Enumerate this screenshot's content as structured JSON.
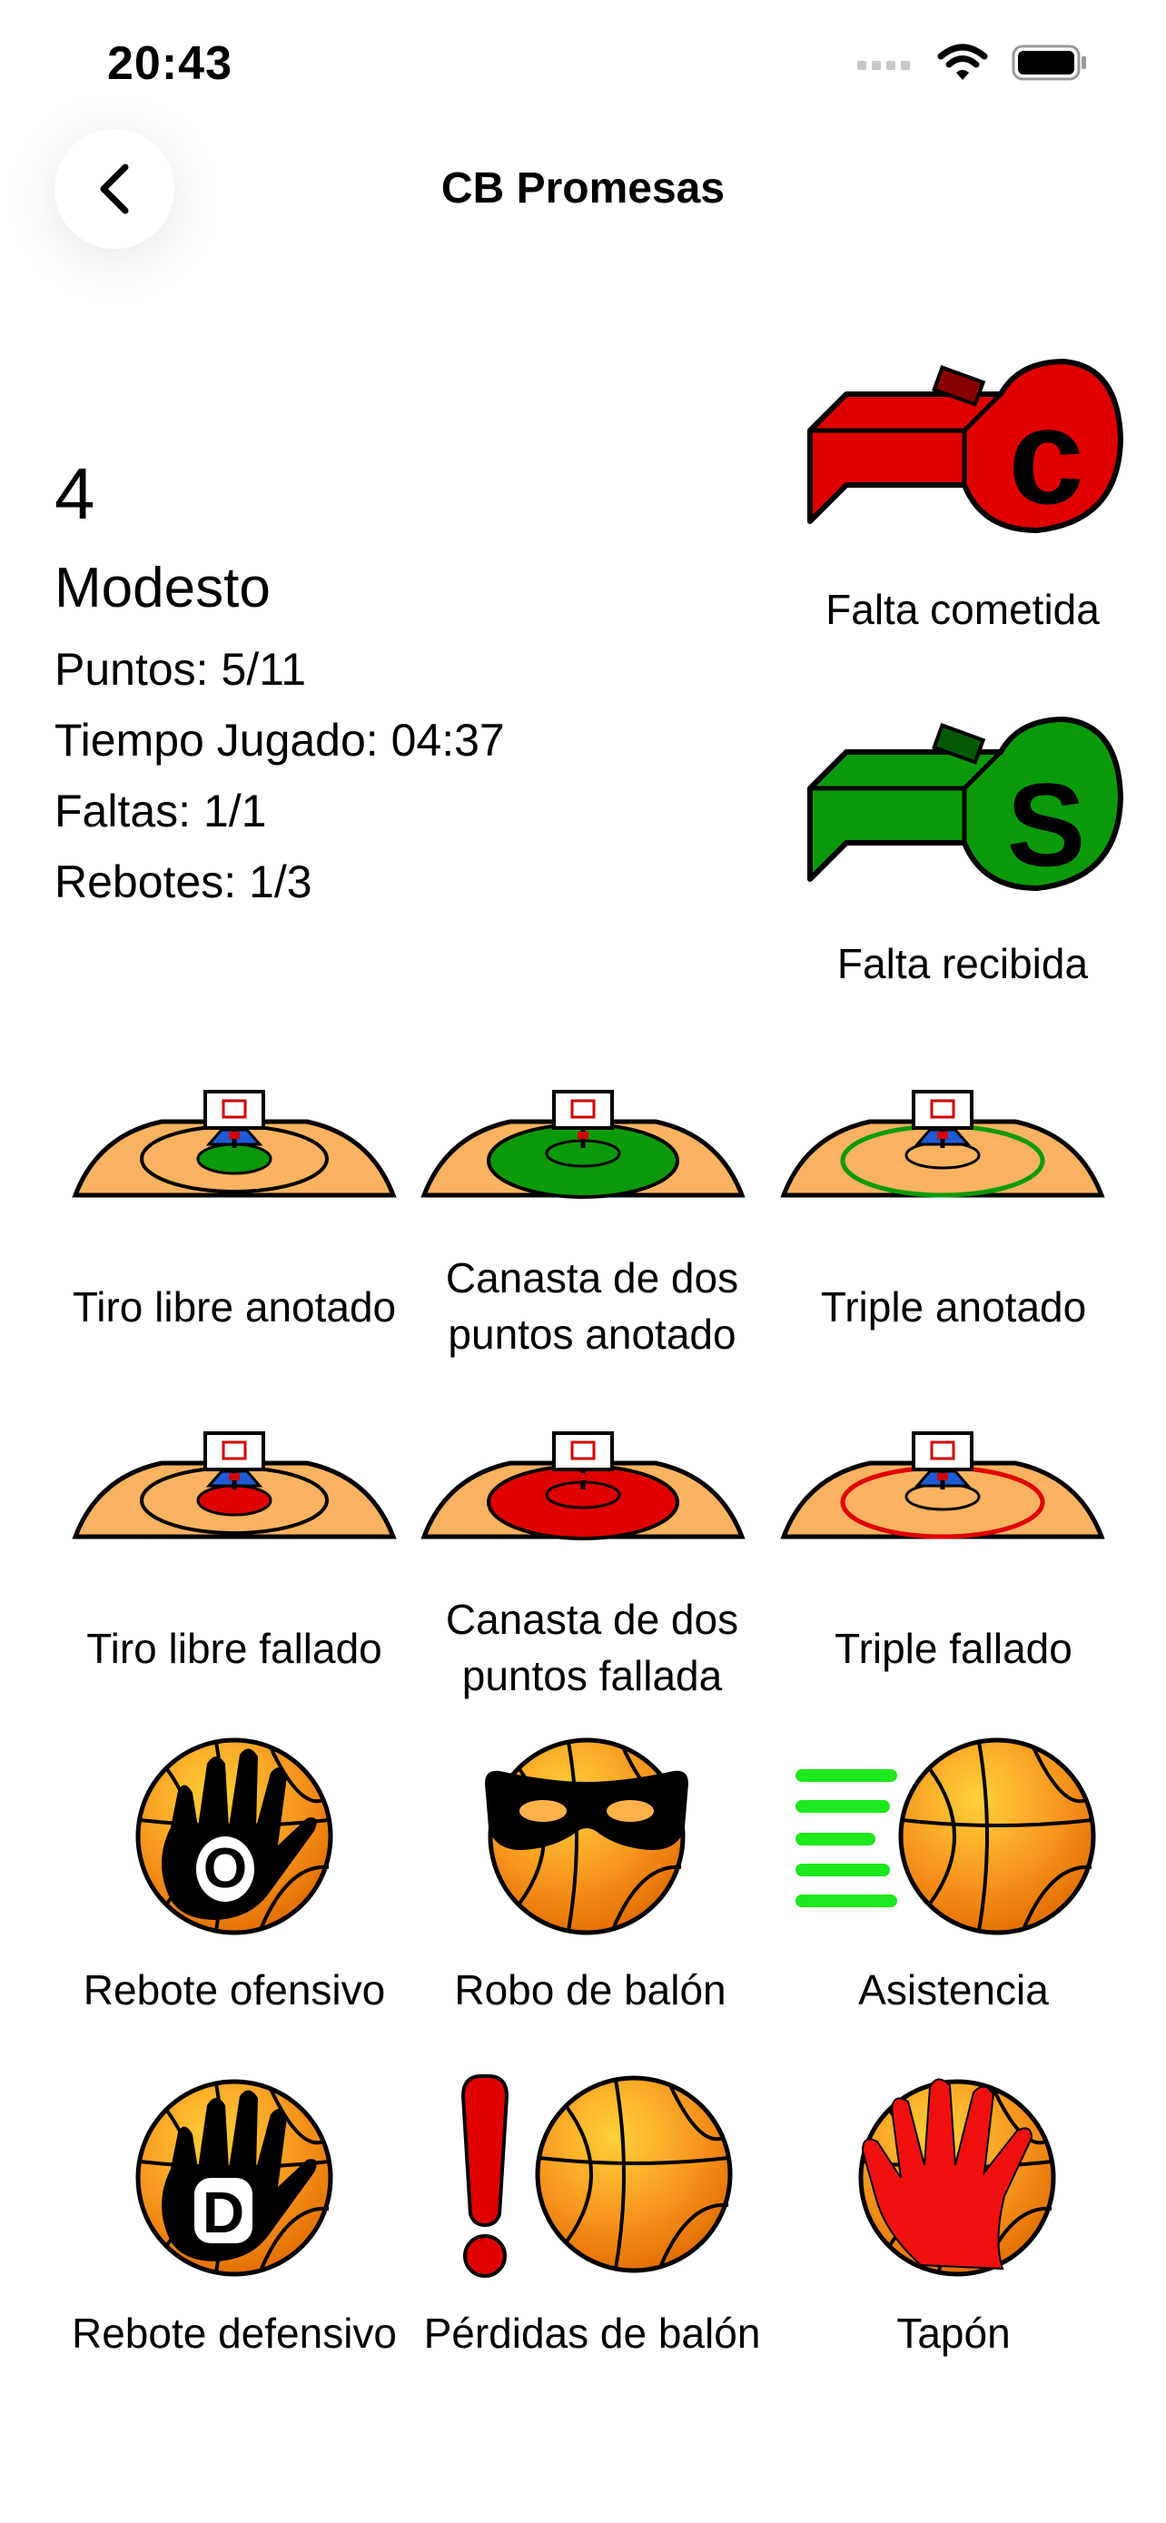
{
  "status_bar": {
    "time": "20:43"
  },
  "nav": {
    "title": "CB Promesas"
  },
  "player": {
    "number": "4",
    "name": "Modesto",
    "stats": [
      "Puntos: 5/11",
      "Tiempo Jugado: 04:37",
      "Faltas: 1/1",
      "Rebotes: 1/3"
    ]
  },
  "fouls": [
    {
      "label": "Falta cometida",
      "letter": "C",
      "color": "#e00000",
      "icon": "whistle-red-icon"
    },
    {
      "label": "Falta recibida",
      "letter": "S",
      "color": "#0a9a0a",
      "icon": "whistle-green-icon"
    }
  ],
  "actions": [
    {
      "label": "Tiro libre anotado",
      "icon": "court-free-throw-made-icon"
    },
    {
      "label": "Canasta de dos puntos anotado",
      "icon": "court-two-points-made-icon"
    },
    {
      "label": "Triple anotado",
      "icon": "court-three-points-made-icon"
    },
    {
      "label": "Tiro libre fallado",
      "icon": "court-free-throw-missed-icon"
    },
    {
      "label": "Canasta de dos puntos fallada",
      "icon": "court-two-points-missed-icon"
    },
    {
      "label": "Triple fallado",
      "icon": "court-three-points-missed-icon"
    },
    {
      "label": "Rebote ofensivo",
      "icon": "offensive-rebound-icon",
      "letter": "O"
    },
    {
      "label": "Robo de balón",
      "icon": "steal-icon"
    },
    {
      "label": "Asistencia",
      "icon": "assist-icon"
    },
    {
      "label": "Rebote defensivo",
      "icon": "defensive-rebound-icon",
      "letter": "D"
    },
    {
      "label": "Pérdidas de balón",
      "icon": "turnover-icon"
    },
    {
      "label": "Tapón",
      "icon": "block-icon"
    }
  ],
  "colors": {
    "made": "#0a9a0a",
    "missed": "#e00000",
    "court": "#f9b360",
    "ball": "#f7941d"
  }
}
